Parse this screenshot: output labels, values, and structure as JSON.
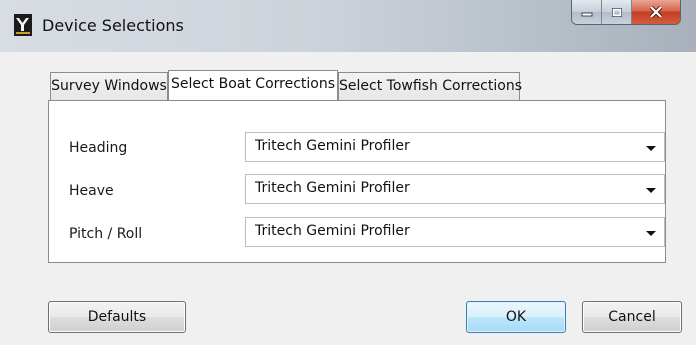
{
  "window": {
    "title": "Device Selections",
    "icon": "app-logo-icon",
    "caption_buttons": [
      "minimize-icon",
      "maximize-icon",
      "close-icon"
    ]
  },
  "tabs": [
    {
      "label": "Survey Windows",
      "active": false
    },
    {
      "label": "Select Boat Corrections",
      "active": true
    },
    {
      "label": "Select Towfish Corrections",
      "active": false
    }
  ],
  "corrections": [
    {
      "label": "Heading",
      "value": "Tritech Gemini Profiler"
    },
    {
      "label": "Heave",
      "value": "Tritech Gemini Profiler"
    },
    {
      "label": "Pitch / Roll",
      "value": "Tritech Gemini Profiler"
    }
  ],
  "buttons": {
    "defaults": "Defaults",
    "ok": "OK",
    "cancel": "Cancel"
  },
  "colors": {
    "close_button": "#c43d23",
    "default_button_border": "#3c7fb1"
  }
}
